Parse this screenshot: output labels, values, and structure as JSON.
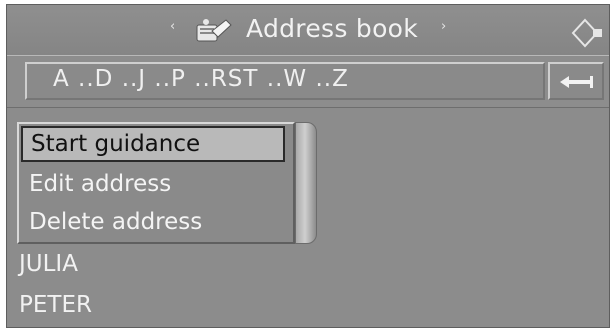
{
  "header": {
    "title": "Address book",
    "prev_arrow": "‹",
    "next_arrow": "›"
  },
  "icons": {
    "book": "address-book-icon",
    "controller": "controller-joystick-icon",
    "back": "back-arrow-icon"
  },
  "alphabet": {
    "label": "A ..D ..J ..P ..RST ..W ..Z"
  },
  "menu": {
    "items": [
      {
        "label": "Start guidance",
        "selected": true
      },
      {
        "label": "Edit address",
        "selected": false
      },
      {
        "label": "Delete address",
        "selected": false
      }
    ]
  },
  "entries": [
    {
      "label": "JULIA"
    },
    {
      "label": "PETER"
    }
  ],
  "colors": {
    "background": "#8c8c8c",
    "selected_bg": "#b9b9b9",
    "text": "#f2f2f2"
  }
}
